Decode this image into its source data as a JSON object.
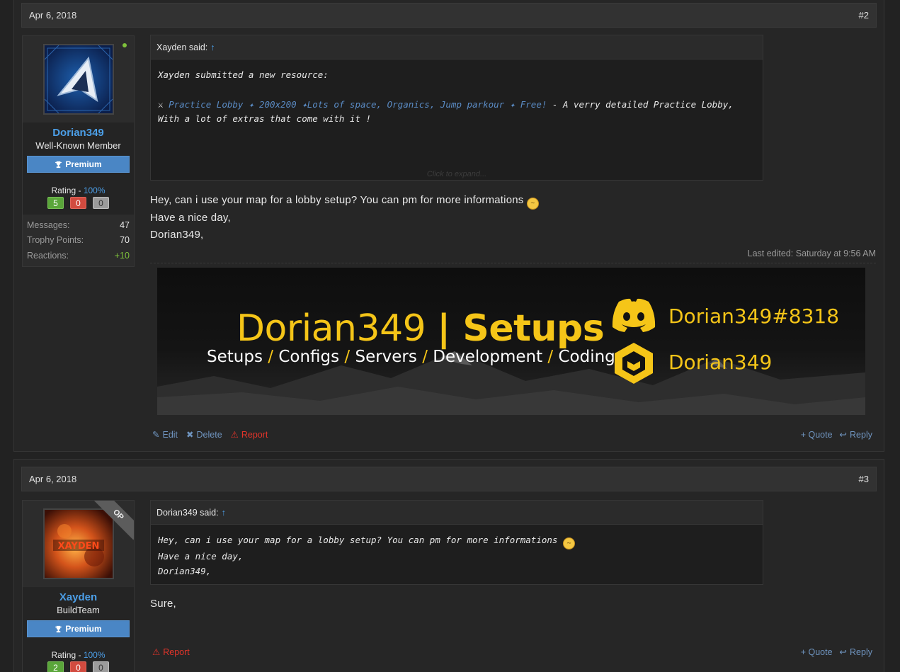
{
  "posts": [
    {
      "date": "Apr 6, 2018",
      "number": "#2",
      "user": {
        "name": "Dorian349",
        "title": "Well-Known Member",
        "premium_label": "Premium",
        "rating_label": "Rating - ",
        "rating_pct": "100%",
        "rating_positive": "5",
        "rating_negative": "0",
        "rating_neutral": "0",
        "stats": [
          {
            "key": "Messages:",
            "value": "47"
          },
          {
            "key": "Trophy Points:",
            "value": "70"
          },
          {
            "key": "Reactions:",
            "value": "+10"
          }
        ]
      },
      "quote": {
        "author": "Xayden said:",
        "arrow": "↑",
        "line1": "Xayden submitted a new resource:",
        "link_text": "Practice Lobby ✦ 200x200 ✦Lots of space, Organics, Jump parkour ✦ Free!",
        "rest_text": " - A verry detailed Practice Lobby, With a lot of extras that come with it !",
        "expand": "Click to expand..."
      },
      "message": {
        "line1": "Hey, can i use your map for a lobby setup? You can pm for more informations",
        "line2": "Have a nice day,",
        "line3": "Dorian349,"
      },
      "last_edited": "Last edited: Saturday at 9:56 AM",
      "banner": {
        "title_a": "Dorian349 ",
        "title_bar": "|",
        "title_b": " Setups",
        "sub": [
          "Setups",
          "Configs",
          "Servers",
          "Development",
          "Coding"
        ],
        "slash": " / ",
        "discord": "Dorian349#8318",
        "user": "Dorian349"
      },
      "actions": {
        "edit": "Edit",
        "delete": "Delete",
        "report": "Report",
        "quote": "+ Quote",
        "reply": "Reply"
      }
    },
    {
      "date": "Apr 6, 2018",
      "number": "#3",
      "user": {
        "name": "Xayden",
        "title": "BuildTeam",
        "premium_label": "Premium",
        "rating_label": "Rating - ",
        "rating_pct": "100%",
        "rating_positive": "2",
        "rating_negative": "0",
        "rating_neutral": "0",
        "op_badge": "OP"
      },
      "quote": {
        "author": "Dorian349 said:",
        "arrow": "↑",
        "line1": "Hey, can i use your map for a lobby setup? You can pm for more informations",
        "line2": "Have a nice day,",
        "line3": "Dorian349,"
      },
      "message": {
        "line1": "Sure,"
      },
      "actions": {
        "report": "Report",
        "quote": "+ Quote",
        "reply": "Reply"
      }
    }
  ],
  "colors": {
    "accent": "#4c9fe8",
    "banner_yellow": "#f5c518",
    "report_red": "#e2342a",
    "positive": "#7ec13b"
  }
}
